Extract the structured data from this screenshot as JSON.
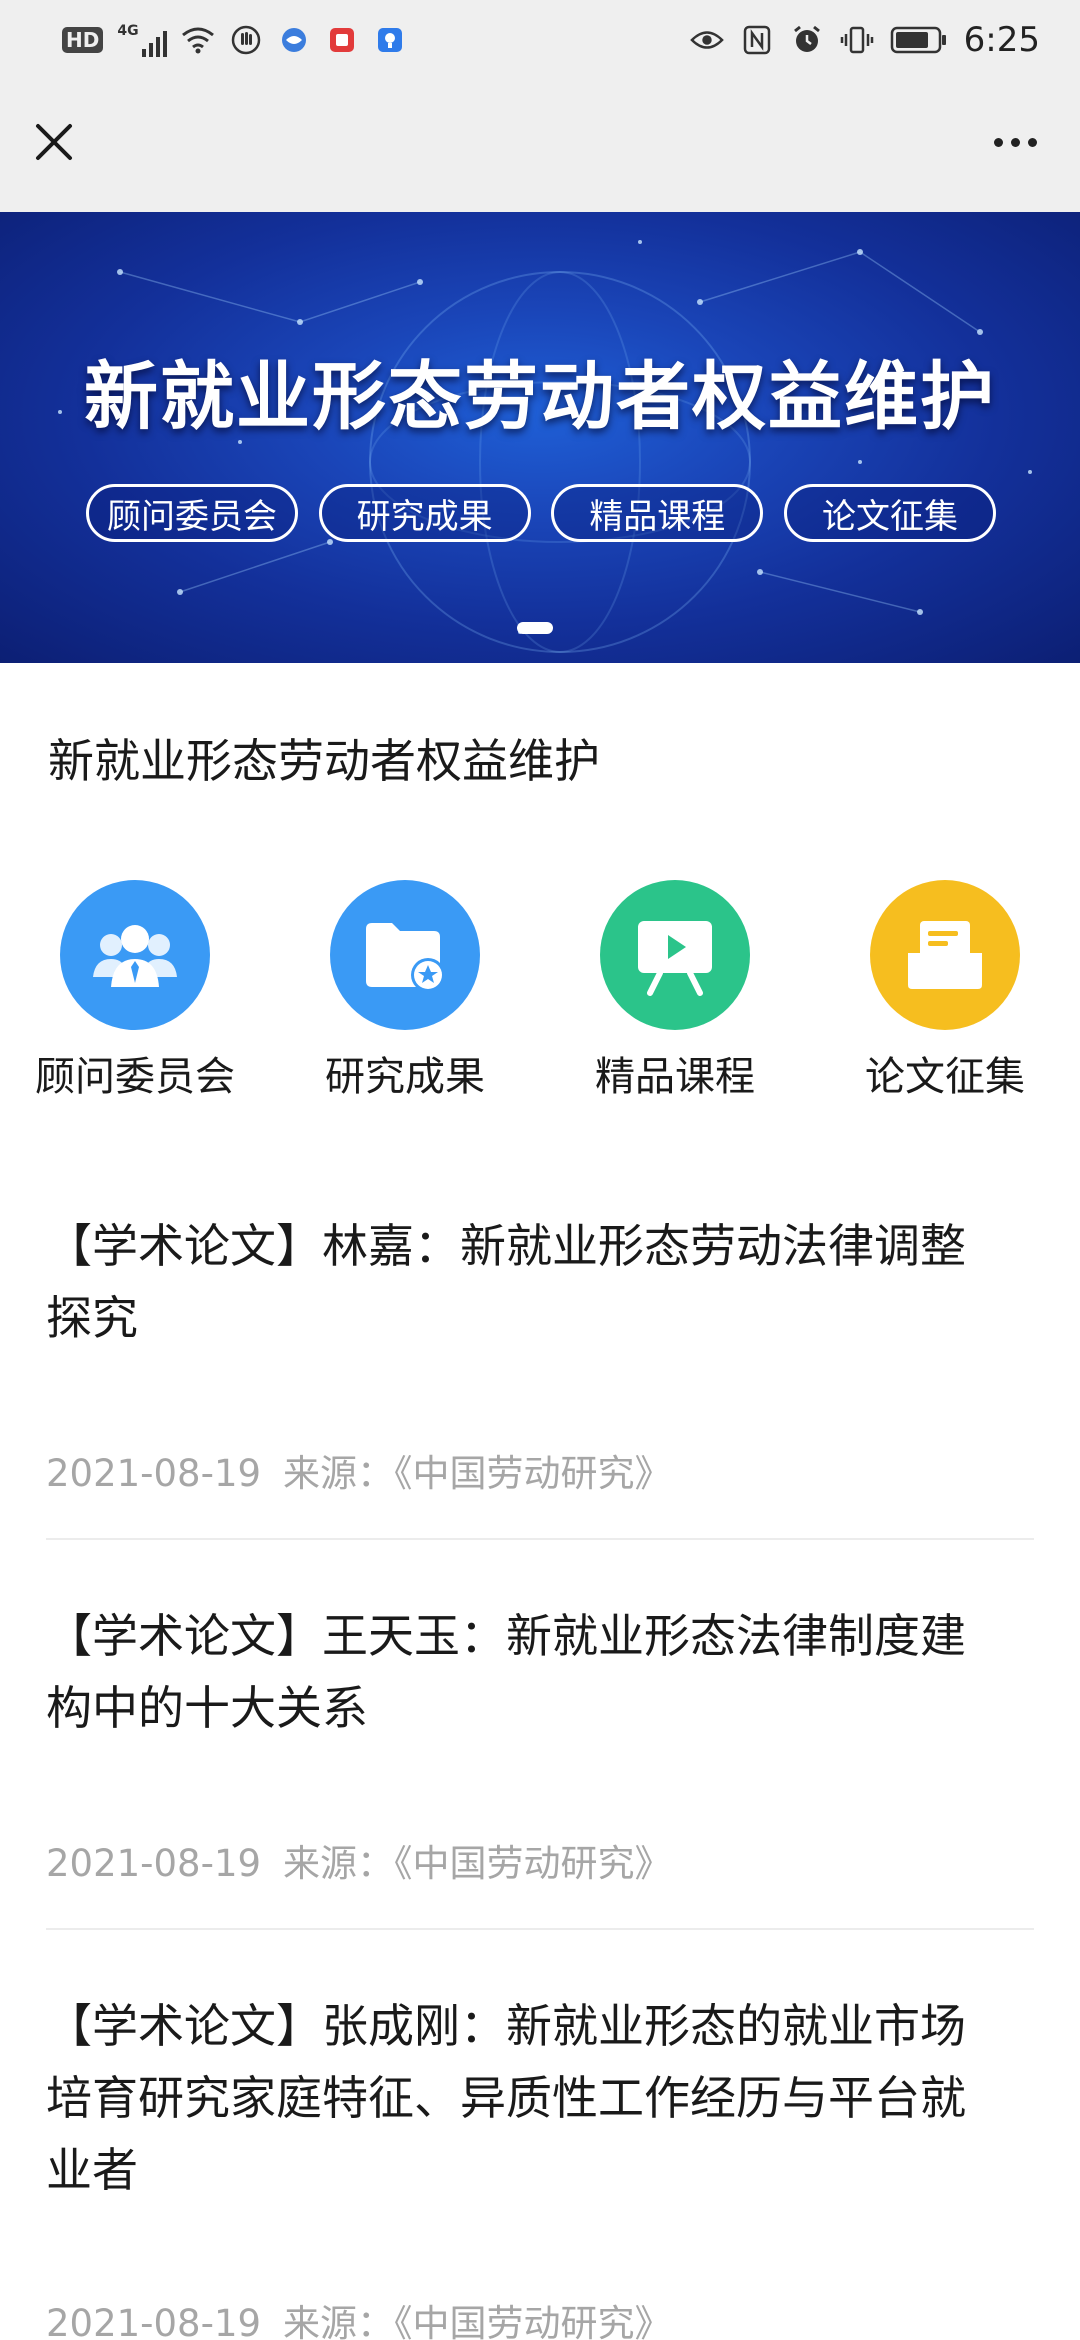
{
  "status_bar": {
    "network_badge": "HD",
    "network_type": "4G",
    "time": "6:25"
  },
  "title_bar": {
    "close_icon": "close-icon",
    "more_icon": "more-icon"
  },
  "banner": {
    "title": "新就业形态劳动者权益维护",
    "tags": [
      "顾问委员会",
      "研究成果",
      "精品课程",
      "论文征集"
    ],
    "colors": {
      "bg_center": "#1f5fd6",
      "bg_edge": "#0c1f74"
    }
  },
  "page": {
    "title": "新就业形态劳动者权益维护"
  },
  "quick_nav": [
    {
      "label": "顾问委员会",
      "icon": "advisors-icon",
      "color": "#3a9af5"
    },
    {
      "label": "研究成果",
      "icon": "folder-star-icon",
      "color": "#3a9af5"
    },
    {
      "label": "精品课程",
      "icon": "presentation-play-icon",
      "color": "#2bc48a"
    },
    {
      "label": "论文征集",
      "icon": "document-tray-icon",
      "color": "#f6be1f"
    }
  ],
  "articles": [
    {
      "title_line1": "【学术论文】林嘉：新就业形态劳动法律调整",
      "title_line2": "探究",
      "date": "2021-08-19",
      "source": "来源：《中国劳动研究》"
    },
    {
      "title_line1": "【学术论文】王天玉：新就业形态法律制度建",
      "title_line2": "构中的十大关系",
      "date": "2021-08-19",
      "source": "来源：《中国劳动研究》"
    },
    {
      "title_line1": "【学术论文】张成刚：新就业形态的就业市场",
      "title_line2": "培育研究家庭特征、异质性工作经历与平台就",
      "title_line3": "业者",
      "date": "2021-08-19",
      "source": "来源：《中国劳动研究》"
    }
  ]
}
